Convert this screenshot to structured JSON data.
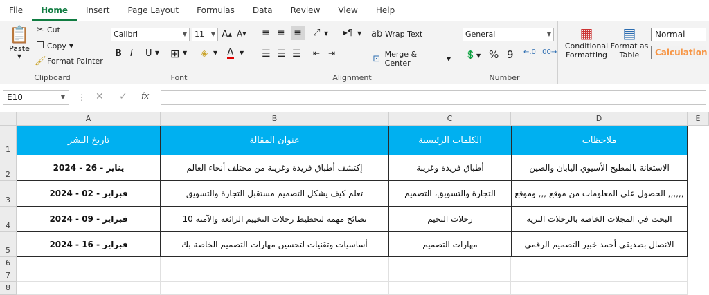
{
  "menu": {
    "tabs": [
      "File",
      "Home",
      "Insert",
      "Page Layout",
      "Formulas",
      "Data",
      "Review",
      "View",
      "Help"
    ],
    "active": "Home"
  },
  "clipboard": {
    "paste": "Paste",
    "cut": "Cut",
    "copy": "Copy",
    "format_painter": "Format Painter",
    "label": "Clipboard"
  },
  "font": {
    "name": "Calibri",
    "size": "11",
    "label": "Font"
  },
  "alignment": {
    "wrap": "Wrap Text",
    "merge": "Merge & Center",
    "label": "Alignment"
  },
  "number": {
    "format": "General",
    "label": "Number"
  },
  "styles": {
    "conditional": "Conditional",
    "conditional2": "Formatting",
    "format_as": "Format as",
    "format_as2": "Table",
    "normal": "Normal",
    "calculation": "Calculation"
  },
  "formula_bar": {
    "name_box": "E10",
    "fx": "fx",
    "value": ""
  },
  "columns": [
    "A",
    "B",
    "C",
    "D",
    "E"
  ],
  "rows": [
    "1",
    "2",
    "3",
    "4",
    "5",
    "6",
    "7",
    "8"
  ],
  "table": {
    "headers": [
      "تاريخ النشر",
      "عنوان المقالة",
      "الكلمات الرئيسية",
      "ملاحظات"
    ],
    "rows": [
      [
        "يناير - 26 - 2024",
        "إكتشف أطباق فريدة وغريبة من مختلف أنحاء العالم",
        "أطباق فريدة وغريبة",
        "الاستعانة بالمطبخ الأسيوي اليابان والصين"
      ],
      [
        "فبراير - 02 - 2024",
        "تعلم كيف يشكل التصميم مستقبل التجارة والتسويق",
        "التجارة والتسويق، التصميم",
        "الحصول على المعلومات من موقع ,,, وموقع ,,,,,,"
      ],
      [
        "فبراير - 09 - 2024",
        "نصائح مهمة لتخطيط رحلات التخييم الرائعة والآمنة 10",
        "رحلات التخيم",
        "البحث في المجلات الخاصة بالرحلات البرية"
      ],
      [
        "فبراير - 16 - 2024",
        "أساسيات وتقنيات لتحسين مهارات التصميم الخاصة بك",
        "مهارات التصميم",
        "الانصال بصديقي أحمد خبير التصميم الرقمي"
      ]
    ]
  },
  "colors": {
    "accent": "#107c41",
    "header_fill": "#00b0f0",
    "calc_text": "#f79646"
  }
}
